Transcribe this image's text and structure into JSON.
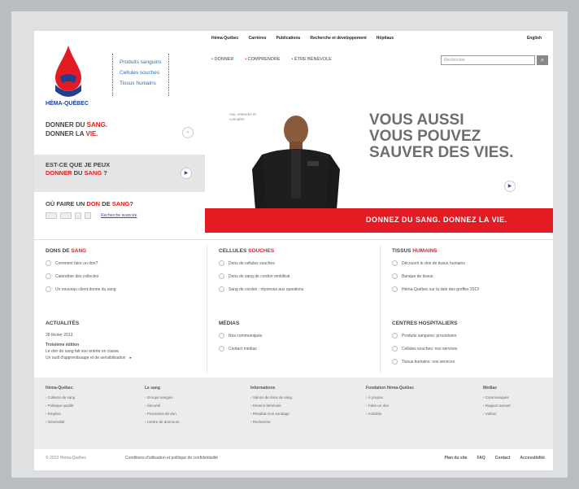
{
  "brand": {
    "name": "HÉMA-QUÉBEC",
    "links": [
      "Produits sanguins",
      "Cellules souches",
      "Tissus humains"
    ],
    "colors": {
      "red": "#e31b23",
      "blue": "#1f3f8f",
      "link": "#2d6fb2"
    }
  },
  "topnav": [
    "Héma-Québec",
    "Carrières",
    "Publications",
    "Recherche et développement",
    "Hôpitaux",
    "English"
  ],
  "mainnav": [
    "DONNER",
    "COMPRENDRE",
    "ÊTRE BÉNÉVOLE"
  ],
  "search": {
    "placeholder": "Rechercher",
    "button_icon": "search-icon"
  },
  "left": {
    "b1_line1_a": "DONNER DU ",
    "b1_line1_b": "SANG.",
    "b1_line2_a": "DONNER LA ",
    "b1_line2_b": "VIE.",
    "b2_line1": "EST-CE QUE JE PEUX",
    "b2_line2_a": "DONNER",
    "b2_line2_b": " DU ",
    "b2_line2_c": "SANG",
    "b2_line2_d": " ?",
    "b3_a": "OÙ FAIRE UN ",
    "b3_b": "DON",
    "b3_c": " DE ",
    "b3_d": "SANG",
    "b3_e": "?",
    "b3_link": "Recherche avancée"
  },
  "hero": {
    "small_text": "Voir, entendre et connaître",
    "h1_line1": "VOUS AUSSI",
    "h1_line2": "VOUS POUVEZ",
    "h1_line3": "SAUVER DES VIES.",
    "band": "DONNEZ DU SANG. DONNEZ LA VIE."
  },
  "columns": {
    "dons": {
      "title_a": "DONS DE ",
      "title_b": "SANG",
      "items": [
        "Comment faire un don?",
        "Calendrier des collectes",
        "Un nouveau client donne du sang"
      ]
    },
    "actualites": {
      "title": "ACTUALITÉS",
      "date": "28 février 2013",
      "headline": "Troisième édition",
      "text1": "Le don de sang fait son entrée en classe",
      "text2": "Un outil d'apprentissage et de sensibilisation"
    },
    "cellules": {
      "title_a": "CELLULES ",
      "title_b": "SOUCHES",
      "items": [
        "Dons de cellules souches",
        "Dons de sang de cordon ombilical",
        "Sang de cordon : réponses aux questions"
      ]
    },
    "medias": {
      "title": "MÉDIAS",
      "items": [
        "Nos communiqués",
        "Contact médias"
      ]
    },
    "tissus": {
      "title_a": "TISSUS ",
      "title_b": "HUMAINS",
      "items": [
        "Découvrir le don de tissus humains",
        "Banque de tissus",
        "Héma-Québec sur la liste des greffes 2013"
      ]
    },
    "centres": {
      "title": "CENTRES HOSPITALIERS",
      "items": [
        "Produits sanguins: procédures",
        "Cellules souches: nos services",
        "Tissus humains: nos services"
      ]
    }
  },
  "footer": {
    "cols": [
      {
        "title": "Héma-Québec",
        "items": [
          "Collecte de sang",
          "Politique qualité",
          "Emplois",
          "Généralité"
        ]
      },
      {
        "title": "Le sang",
        "items": [
          "Groupe sanguin",
          "Sécurité",
          "Processus de don",
          "Centre de donneurs"
        ]
      },
      {
        "title": "Informations",
        "items": [
          "Salons de dons de sang",
          "Devenir bénévole",
          "Résultat mon sondage",
          "Recherche"
        ]
      },
      {
        "title": "Fondation Héma-Québec",
        "items": [
          "À propos",
          "Faire un don",
          "Activités"
        ]
      },
      {
        "title": "Médias",
        "items": [
          "Communiqués",
          "Rapport annuel",
          "Vidéos"
        ]
      }
    ]
  },
  "bottom": {
    "copyright": "© 2013 Héma-Québec",
    "conditions": "Conditions d'utilisation et politique de confidentialité",
    "links": [
      "Plan du site",
      "FAQ",
      "Contact",
      "Accessibilité"
    ]
  }
}
